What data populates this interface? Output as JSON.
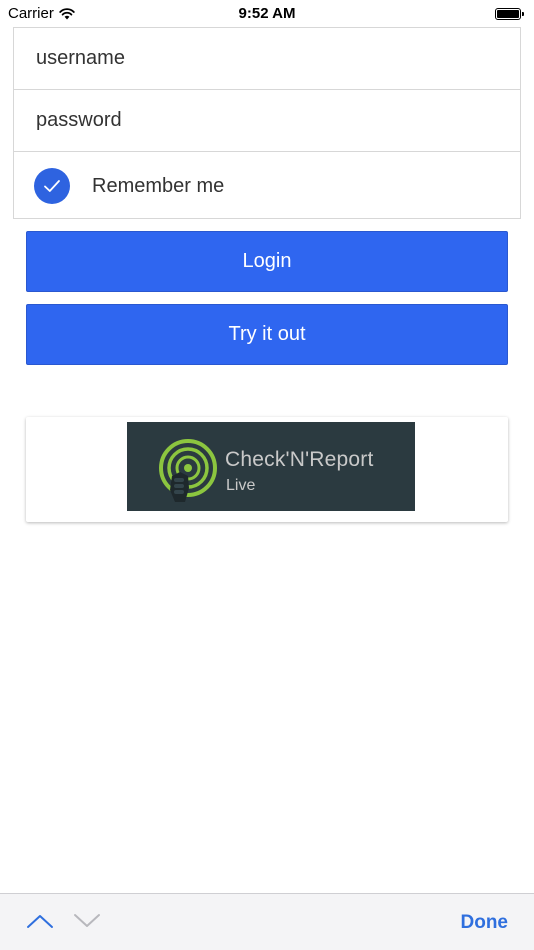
{
  "status_bar": {
    "carrier": "Carrier",
    "time": "9:52 AM",
    "battery_level": 1.0,
    "icons": [
      "wifi-icon",
      "battery-icon"
    ]
  },
  "login_form": {
    "username_placeholder": "username",
    "password_placeholder": "password",
    "remember_me_label": "Remember me",
    "remember_me_checked": true,
    "icons": [
      "checkmark-icon"
    ]
  },
  "buttons": {
    "login_label": "Login",
    "try_label": "Try it out"
  },
  "logo": {
    "name": "Check'N'Report",
    "sub": "Live",
    "icons": [
      "signal-hand-logo-icon"
    ]
  },
  "toolbar": {
    "done_label": "Done",
    "icons": [
      "chevron-up-icon",
      "chevron-down-icon"
    ]
  },
  "colors": {
    "accent": "#2f66f0",
    "check": "#2e63e0",
    "done_text": "#2f6fde",
    "logo_green": "#8cc63f",
    "logo_bg": "#2b3a40"
  }
}
